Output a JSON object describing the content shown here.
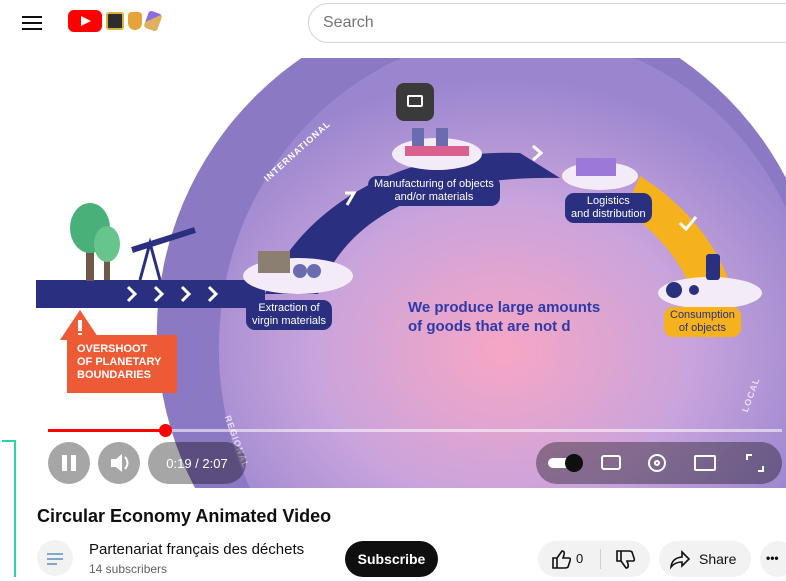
{
  "header": {
    "search_placeholder": "Search"
  },
  "video": {
    "scene": {
      "international_label": "INTERNATIONAL",
      "regional_label": "REGIONAL",
      "local_label": "LOCAL",
      "steps": [
        {
          "label": "Extraction of\nvirgin materials"
        },
        {
          "label": "Manufacturing of objects\nand/or materials"
        },
        {
          "label": "Logistics\nand distribution"
        },
        {
          "label": "Consumption\nof objects"
        }
      ],
      "headline": "We produce large amounts\nof goods that are not d",
      "overshoot": "OVERSHOOT\nOF PLANETARY\nBOUNDARIES",
      "colors": {
        "purple": "#8c79c4",
        "navy": "#2b2f80",
        "orange": "#ec5b35",
        "yellow": "#f6b21c",
        "headline": "#2e3aa8"
      }
    },
    "player": {
      "time": "0:19 / 2:07",
      "progress_fraction": 0.16,
      "buttons": [
        "pause-icon",
        "volume-icon",
        "autoplay-toggle",
        "captions-icon",
        "settings-icon",
        "miniplayer-icon",
        "fullscreen-icon"
      ]
    }
  },
  "details": {
    "title": "Circular Economy Animated Video",
    "channel_name": "Partenariat français des déchets",
    "subscribers": "14 subscribers",
    "subscribe_label": "Subscribe",
    "likes": "0",
    "share_label": "Share",
    "more_label": "•••"
  }
}
